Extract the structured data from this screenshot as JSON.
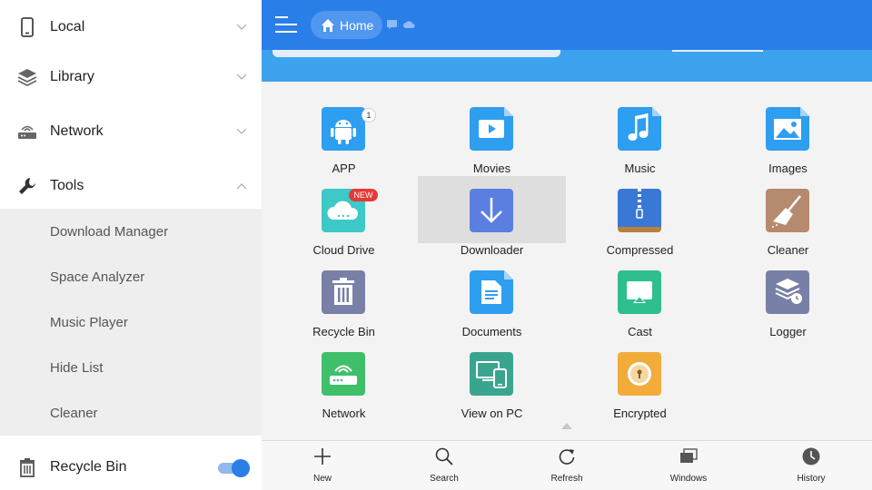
{
  "sidebar": {
    "items": [
      {
        "label": "Local"
      },
      {
        "label": "Library"
      },
      {
        "label": "Network"
      },
      {
        "label": "Tools"
      }
    ],
    "tools_sub": [
      {
        "label": "Download Manager"
      },
      {
        "label": "Space Analyzer"
      },
      {
        "label": "Music Player"
      },
      {
        "label": "Hide List"
      },
      {
        "label": "Cleaner"
      }
    ],
    "recycle_bin": {
      "label": "Recycle Bin",
      "toggle_on": true
    }
  },
  "header": {
    "home_label": "Home"
  },
  "grid": {
    "items": [
      {
        "label": "APP",
        "icon": "android-icon",
        "badge": "1"
      },
      {
        "label": "Movies",
        "icon": "movie-icon"
      },
      {
        "label": "Music",
        "icon": "music-icon"
      },
      {
        "label": "Images",
        "icon": "image-icon"
      },
      {
        "label": "Cloud Drive",
        "icon": "cloud-icon",
        "badge": "NEW"
      },
      {
        "label": "Downloader",
        "icon": "download-icon",
        "selected": true
      },
      {
        "label": "Compressed",
        "icon": "zip-icon"
      },
      {
        "label": "Cleaner",
        "icon": "broom-icon"
      },
      {
        "label": "Recycle Bin",
        "icon": "trash-icon"
      },
      {
        "label": "Documents",
        "icon": "document-icon"
      },
      {
        "label": "Cast",
        "icon": "cast-icon"
      },
      {
        "label": "Logger",
        "icon": "logger-icon"
      },
      {
        "label": "Network",
        "icon": "router-icon"
      },
      {
        "label": "View on PC",
        "icon": "view-on-pc-icon"
      },
      {
        "label": "Encrypted",
        "icon": "lock-icon"
      }
    ]
  },
  "bottom_bar": {
    "new_label": "New",
    "search_label": "Search",
    "refresh_label": "Refresh",
    "windows_label": "Windows",
    "history_label": "History"
  },
  "colors": {
    "header": "#2a7ee8",
    "accent": "#2a7ee8",
    "selected_cell": "#dedede"
  }
}
